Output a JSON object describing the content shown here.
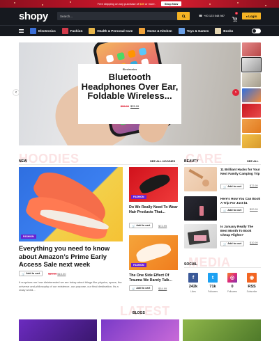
{
  "promo": {
    "text_before": "Free shipping on any purchase of ",
    "text_highlight": "$35",
    "text_after": " or more.",
    "button_label": "Shop Now"
  },
  "header": {
    "logo": "shopy",
    "search_placeholder": "Search...",
    "phone": "+00 123 548 987",
    "cart_count": "0",
    "login_label": "Login"
  },
  "nav": {
    "items": [
      {
        "label": "Electronics",
        "color": "#3a6fd8"
      },
      {
        "label": "Fashion",
        "color": "#d23b4b"
      },
      {
        "label": "Health & Personal Care",
        "color": "#e8b64a"
      },
      {
        "label": "Home & Kitchen",
        "color": "#f1a33a"
      },
      {
        "label": "Toys & Games",
        "color": "#6aa0e8"
      },
      {
        "label": "Books",
        "color": "#e5d6b2"
      }
    ]
  },
  "hero": {
    "category": "Electronics",
    "title": "Bluetooth Headphones Over Ear, Foldable Wireless...",
    "old_price": "$39.99",
    "new_price": "$25.99"
  },
  "hoodies": {
    "ghost": "HOODIES",
    "label": "NEW",
    "see_all": "SEE ALL HOODIES",
    "feature": {
      "category": "FASHION",
      "title": "Everything you need to know about Amazon’s Prime Early Access Sale next week",
      "old_price": "$19.99",
      "new_price": "$15.00",
      "add_to_cart": "Add to cart",
      "excerpt": "It surprises me how disinterested we are today about things like physics, space, the universe and philosophy of our existence, our purpose, our final destination. Its a crazy world..."
    },
    "items": [
      {
        "category": "FASHION",
        "title": "Do We Really Need To Wear Hair Products That...",
        "add_to_cart": "Add to cart",
        "price": "$72.99"
      },
      {
        "category": "FASHION",
        "title": "The One Side Effect Of Trauma We Rarely Talk...",
        "add_to_cart": "Add to cart",
        "price": "$54.99"
      }
    ]
  },
  "beauty": {
    "ghost": "CARE",
    "label": "BEAUTY",
    "see_all": "SEE ALL",
    "items": [
      {
        "title": "11 Brilliant Hacks for Your Next Family Camping Trip",
        "add_to_cart": "Add to cart",
        "price": "$72.99"
      },
      {
        "title": "Here's How You Can Book A Trip For Just $1",
        "add_to_cart": "Add to cart",
        "price": "$20.99"
      },
      {
        "title": "Is January Really The Best Month To Book Cheap Flights?",
        "add_to_cart": "Add to cart",
        "price": "$10.99"
      }
    ]
  },
  "social": {
    "ghost": "MEDIA",
    "label": "SOCIAL",
    "items": [
      {
        "icon": "facebook-icon",
        "glyph": "f",
        "count": "242k",
        "label": "Likes",
        "color": "#3b5998"
      },
      {
        "icon": "twitter-icon",
        "glyph": "t",
        "count": "71k",
        "label": "Followers",
        "color": "#1da1f2"
      },
      {
        "icon": "instagram-icon",
        "glyph": "◎",
        "count": "0",
        "label": "Followers",
        "color": "#c13584"
      },
      {
        "icon": "rss-icon",
        "glyph": "◉",
        "count": "RSS",
        "label": "Subscribe",
        "color": "#f26522"
      }
    ]
  },
  "blogs": {
    "ghost": "LATEST",
    "label": "BLOGS"
  }
}
